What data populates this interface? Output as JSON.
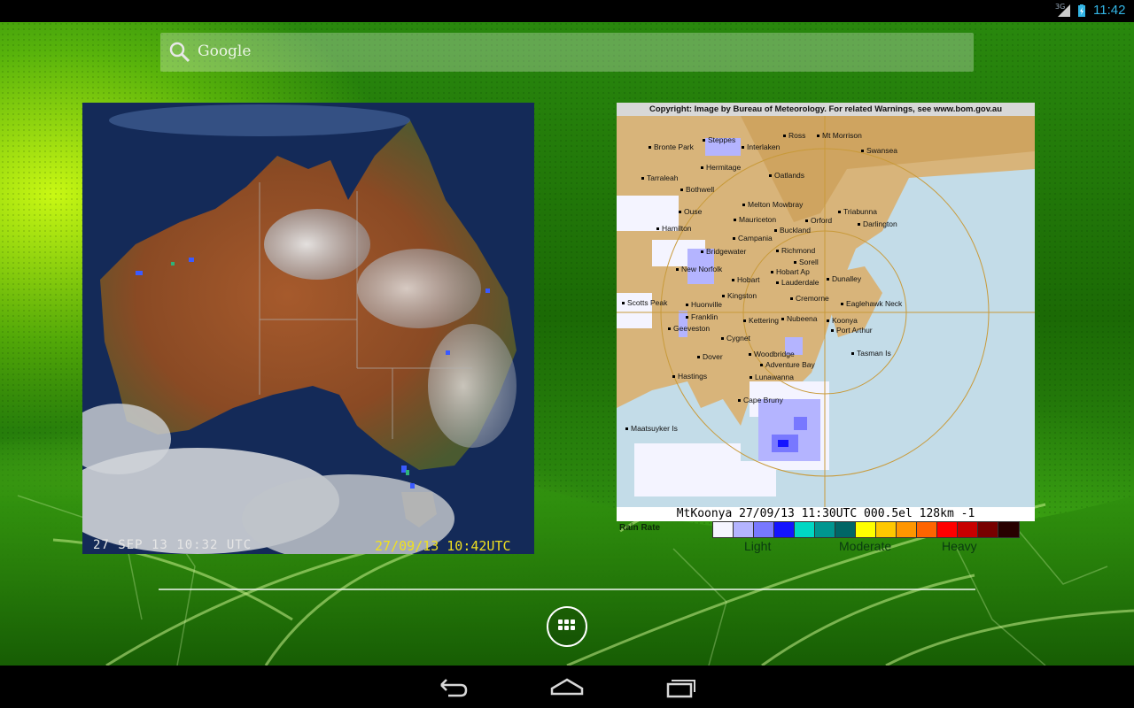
{
  "status_bar": {
    "network": "3G",
    "clock": "11:42",
    "icons": [
      "signal-icon",
      "battery-charging-icon"
    ]
  },
  "search": {
    "label": "Google",
    "icon": "search-icon"
  },
  "satellite": {
    "left_stamp": "27 SEP 13 10:32 UTC",
    "right_stamp": "27/09/13 10:42UTC"
  },
  "radar": {
    "copyright": "Copyright: Image by Bureau of Meteorology. For related Warnings, see www.bom.gov.au",
    "caption": "MtKoonya 27/09/13 11:30UTC 000.5el 128km -1",
    "rain_rate_label": "Rain Rate",
    "scale_labels": {
      "light": "Light",
      "moderate": "Moderate",
      "heavy": "Heavy"
    },
    "scale_colors": [
      "#f5f5ff",
      "#b4b4ff",
      "#7878ff",
      "#1414ff",
      "#00d8c3",
      "#009690",
      "#006666",
      "#ffff00",
      "#ffc800",
      "#ff9600",
      "#ff6400",
      "#ff0000",
      "#c80000",
      "#780000",
      "#280000"
    ],
    "places": [
      "Ross",
      "Mt Morrison",
      "Steppes",
      "Bronte Park",
      "Interlaken",
      "Swansea",
      "Hermitage",
      "Tarraleah",
      "Oatlands",
      "Bothwell",
      "Melton Mowbray",
      "Triabunna",
      "Ouse",
      "Mauriceton",
      "Orford",
      "Darlington",
      "Hamilton",
      "Buckland",
      "Campania",
      "Richmond",
      "Bridgewater",
      "Sorell",
      "New Norfolk",
      "Hobart Ap",
      "Dunalley",
      "Hobart",
      "Lauderdale",
      "Kingston",
      "Cremorne",
      "Scotts Peak",
      "Eaglehawk Neck",
      "Huonville",
      "Franklin",
      "Kettering",
      "Nubeena",
      "Koonya",
      "Geeveston",
      "Port Arthur",
      "Cygnet",
      "Tasman Is",
      "Woodbridge",
      "Dover",
      "Adventure Bay",
      "Hastings",
      "Lunawanna",
      "Cape Bruny",
      "Maatsuyker Is"
    ]
  },
  "nav": {
    "back": "back-icon",
    "home": "home-icon",
    "recents": "recents-icon"
  }
}
